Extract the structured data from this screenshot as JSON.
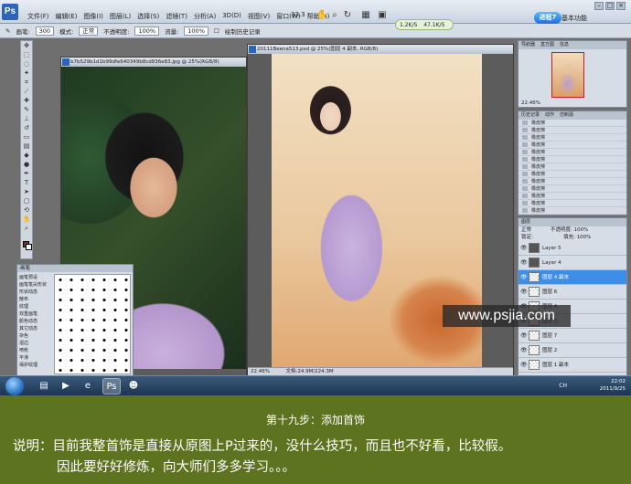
{
  "menubar": {
    "logo": "Ps",
    "menus": [
      "文件(F)",
      "编辑(E)",
      "图像(I)",
      "图层(L)",
      "选择(S)",
      "滤镜(T)",
      "分析(A)",
      "3D(D)",
      "视图(V)",
      "窗口(W)",
      "帮助(H)"
    ],
    "zoom": "33.3",
    "speed_badge": "进程7",
    "workspace": "基本功能",
    "window_controls": [
      "–",
      "□",
      "×"
    ]
  },
  "bridge_pill": {
    "up": "1.2K/S",
    "down": "47.1K/S"
  },
  "options": {
    "brush_label": "画笔:",
    "brush_size": "300",
    "mode_label": "模式:",
    "mode_value": "正常",
    "opacity_label": "不透明度:",
    "opacity_value": "100%",
    "flow_label": "流量:",
    "flow_value": "100%",
    "history_checkbox": "绘制历史记录"
  },
  "doc_left": {
    "title": "b7b529b1d1b99dfe640349b8cd836e83.jpg @ 25%(RGB/8)",
    "status": ""
  },
  "doc_right": {
    "title": "20111Beena513.psd @ 25%(图层 4 副本, RGB/8)",
    "status_zoom": "22.46%",
    "status_doc": "文档:24.9M/224.3M"
  },
  "brushes": {
    "title": "画笔",
    "list": [
      "画笔预设",
      "画笔笔尖形状",
      "形状动态",
      "散布",
      "纹理",
      "双重画笔",
      "颜色动态",
      "其它动态",
      "杂色",
      "湿边",
      "喷枪",
      "平滑",
      "保护纹理"
    ]
  },
  "navigator": {
    "tabs": [
      "导航器",
      "直方图",
      "信息"
    ],
    "zoom": "22.46%"
  },
  "history": {
    "tabs": [
      "历史记录",
      "动作",
      "仿制源"
    ],
    "rows": [
      "橡皮擦",
      "橡皮擦",
      "橡皮擦",
      "橡皮擦",
      "橡皮擦",
      "橡皮擦",
      "橡皮擦",
      "橡皮擦",
      "橡皮擦",
      "橡皮擦",
      "橡皮擦",
      "橡皮擦",
      "橡皮擦"
    ]
  },
  "layers": {
    "tabs": [
      "图层"
    ],
    "blend": "正常",
    "opacity_label": "不透明度:",
    "opacity": "100%",
    "lock_label": "锁定:",
    "fill_label": "填充:",
    "fill": "100%",
    "rows": [
      {
        "name": "Layer 5",
        "dark": true,
        "selected": false
      },
      {
        "name": "Layer 4",
        "dark": true,
        "selected": false
      },
      {
        "name": "图层 4 副本",
        "dark": false,
        "selected": true
      },
      {
        "name": "图层 6",
        "dark": false,
        "selected": false
      },
      {
        "name": "图层 4",
        "dark": false,
        "selected": false
      },
      {
        "name": "图层 3",
        "dark": false,
        "selected": false
      },
      {
        "name": "图层 7",
        "dark": false,
        "selected": false
      },
      {
        "name": "图层 2",
        "dark": false,
        "selected": false
      },
      {
        "name": "图层 1 副本",
        "dark": false,
        "selected": false
      }
    ]
  },
  "watermark": "www.psjia.com",
  "taskbar": {
    "buttons": [
      "explorer-icon",
      "media-icon",
      "ie-icon",
      "photoshop-icon",
      "qq-icon"
    ],
    "tray_lang": "CH",
    "time": "22:02",
    "date": "2011/9/25"
  },
  "caption": {
    "step_title": "第十九步：添加首饰",
    "line1": "说明：目前我整首饰是直接从原图上P过来的，没什么技巧，而且也不好看，比较假。",
    "line2": "因此要好好修炼，向大师们多多学习。。。"
  },
  "colors": {
    "caption_bg": "#5d731f",
    "selected_layer": "#3d8ee8",
    "foreground_swatch": "#6a3b2a"
  }
}
